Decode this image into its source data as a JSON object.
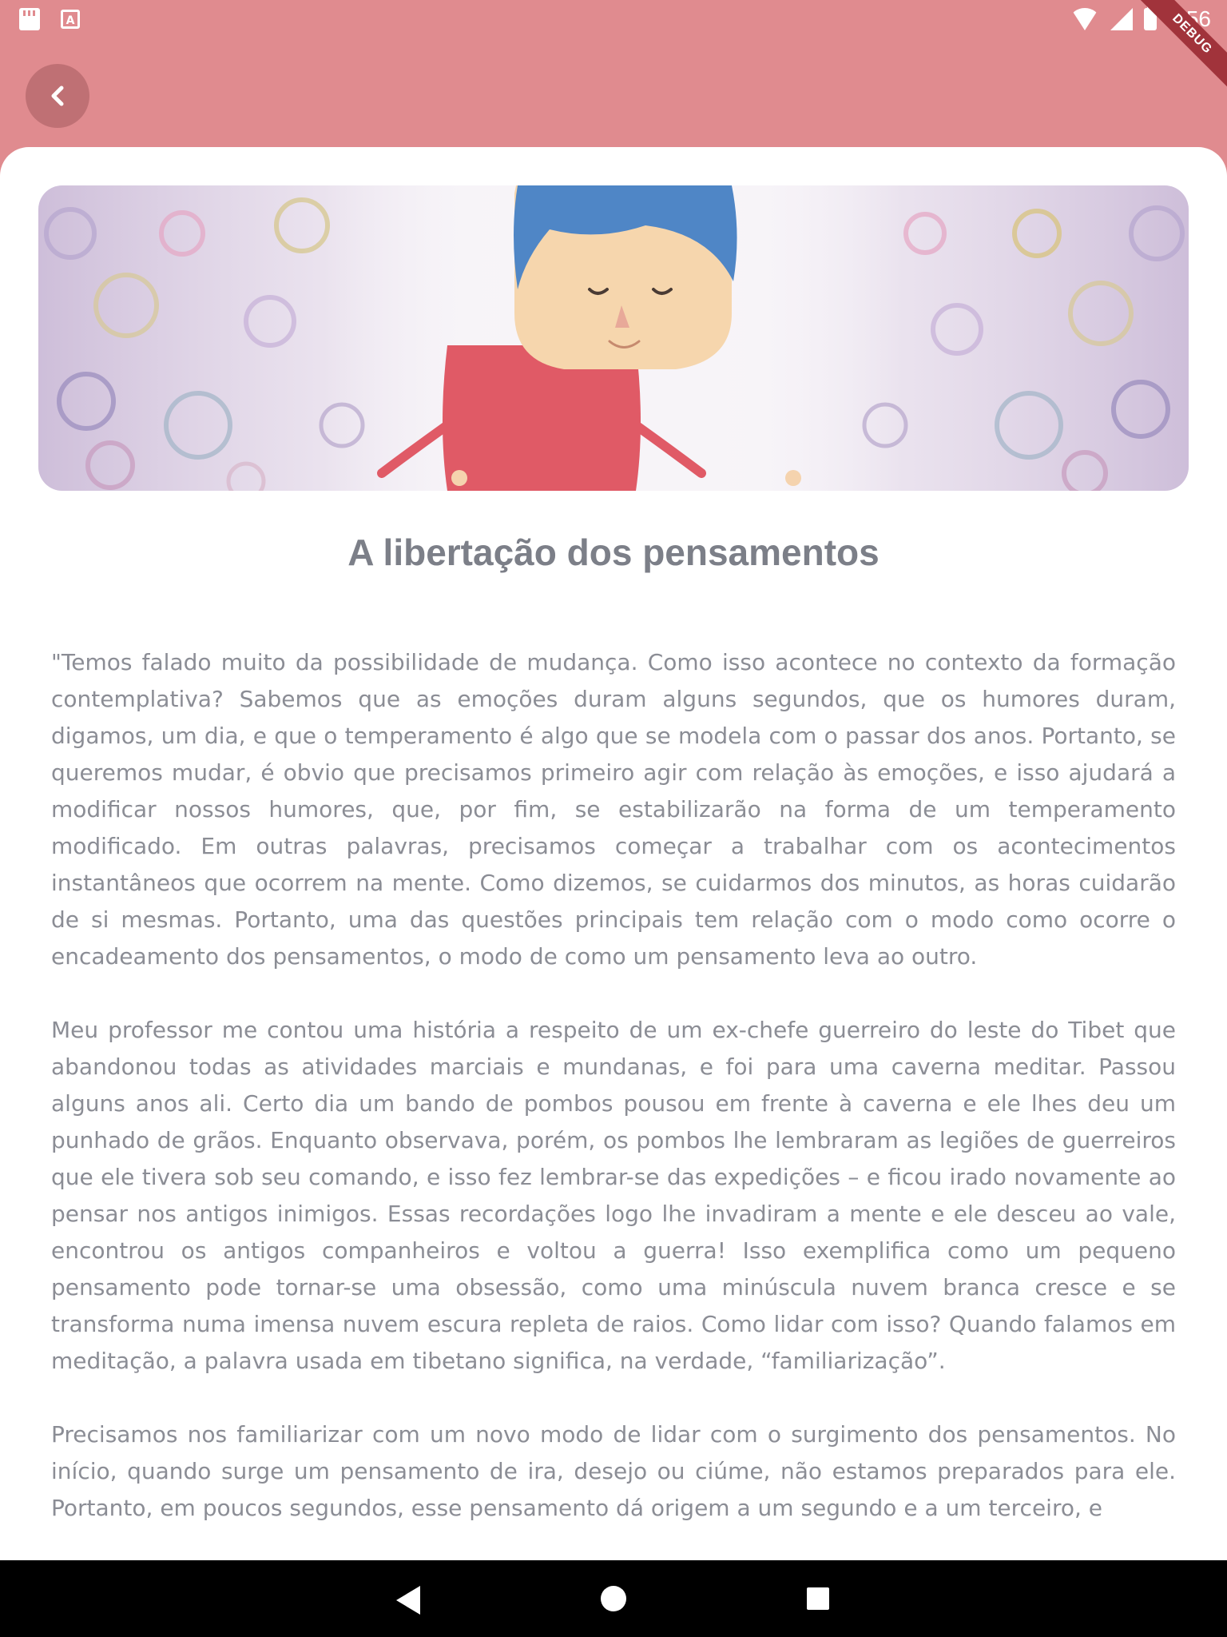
{
  "status_bar": {
    "time": "9:56",
    "icons": [
      "sd-card-icon",
      "font-a-icon",
      "wifi-icon",
      "signal-icon",
      "battery-charging-icon"
    ],
    "debug_label": "DEBUG"
  },
  "header": {
    "back_icon": "chevron-left-icon",
    "bg_color": "#e08b8f"
  },
  "article": {
    "title": "A libertação dos pensamentos",
    "paragraphs": [
      "\"Temos falado muito da possibilidade de mudança. Como isso acontece no contexto da formação contemplativa? Sabemos que as emoções duram alguns segundos, que os humores duram, digamos, um dia, e que o temperamento é algo que se modela com o passar dos anos. Portanto, se queremos mudar, é obvio que precisamos primeiro agir com relação às emoções, e isso ajudará a modificar nossos humores, que, por fim, se estabilizarão na forma de um temperamento modificado. Em outras palavras, precisamos começar a trabalhar com os acontecimentos instantâneos que ocorrem na mente. Como dizemos, se cuidarmos dos minutos, as horas cuidarão de si mesmas. Portanto, uma das questões principais tem relação com o modo como ocorre o encadeamento dos pensamentos, o modo de como um pensamento leva ao outro.",
      "Meu professor me contou uma história a respeito de um ex-chefe guerreiro do leste do Tibet que abandonou todas as atividades marciais e mundanas, e foi para uma caverna meditar. Passou alguns anos ali. Certo dia um bando de pombos pousou em frente à caverna e ele lhes deu um punhado de grãos. Enquanto observava, porém, os pombos lhe lembraram as legiões de guerreiros que ele tivera sob seu comando, e isso fez lembrar-se das expedições – e ficou irado novamente ao pensar nos antigos inimigos. Essas recordações logo lhe invadiram a mente e ele desceu ao vale, encontrou os antigos companheiros e voltou a guerra! Isso exemplifica como um pequeno pensamento pode tornar-se uma obsessão, como uma minúscula nuvem branca cresce e se transforma numa imensa nuvem escura repleta de raios. Como lidar com isso? Quando falamos em meditação, a palavra usada em tibetano significa, na verdade, “familiarização”.",
      "Precisamos nos familiarizar com um novo modo de lidar com o surgimento dos pensamentos. No início, quando surge um pensamento de ira, desejo ou ciúme, não estamos preparados para ele. Portanto, em poucos segundos, esse pensamento dá origem a um segundo e a um terceiro, e"
    ]
  },
  "nav_bar": {
    "icons": [
      "nav-back-icon",
      "nav-home-icon",
      "nav-recents-icon"
    ]
  }
}
